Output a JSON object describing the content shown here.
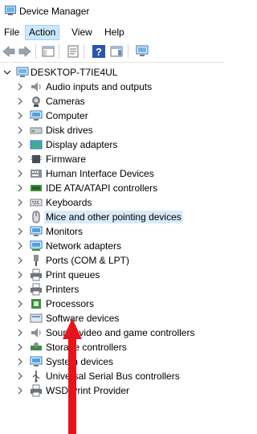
{
  "window": {
    "title": "Device Manager"
  },
  "menu": [
    {
      "label": "File",
      "active": false
    },
    {
      "label": "Action",
      "active": true
    },
    {
      "label": "View",
      "active": false
    },
    {
      "label": "Help",
      "active": false
    }
  ],
  "toolbar": {
    "buttons": [
      "back-arrow-icon",
      "forward-arrow-icon",
      "show-hide-console-tree-icon",
      "properties-icon",
      "help-icon",
      "action-pane-icon",
      "scan-hardware-changes-icon"
    ]
  },
  "tree": {
    "root": {
      "label": "DESKTOP-T7IE4UL"
    },
    "items": [
      {
        "label": "Audio inputs and outputs",
        "icon": "speaker-icon"
      },
      {
        "label": "Cameras",
        "icon": "camera-icon"
      },
      {
        "label": "Computer",
        "icon": "monitor-icon"
      },
      {
        "label": "Disk drives",
        "icon": "disk-drive-icon"
      },
      {
        "label": "Display adapters",
        "icon": "display-adapter-icon"
      },
      {
        "label": "Firmware",
        "icon": "chip-icon"
      },
      {
        "label": "Human Interface Devices",
        "icon": "hid-icon"
      },
      {
        "label": "IDE ATA/ATAPI controllers",
        "icon": "ide-controller-icon"
      },
      {
        "label": "Keyboards",
        "icon": "keyboard-icon"
      },
      {
        "label": "Mice and other pointing devices",
        "icon": "mouse-icon"
      },
      {
        "label": "Monitors",
        "icon": "monitor-icon"
      },
      {
        "label": "Network adapters",
        "icon": "network-icon"
      },
      {
        "label": "Ports (COM & LPT)",
        "icon": "port-icon"
      },
      {
        "label": "Print queues",
        "icon": "printer-icon"
      },
      {
        "label": "Printers",
        "icon": "printer-icon"
      },
      {
        "label": "Processors",
        "icon": "processor-icon"
      },
      {
        "label": "Software devices",
        "icon": "software-device-icon"
      },
      {
        "label": "Sound, video and game controllers",
        "icon": "speaker-icon"
      },
      {
        "label": "Storage controllers",
        "icon": "storage-controller-icon"
      },
      {
        "label": "System devices",
        "icon": "system-device-icon"
      },
      {
        "label": "Universal Serial Bus controllers",
        "icon": "usb-icon"
      },
      {
        "label": "WSD Print Provider",
        "icon": "printer-icon"
      }
    ],
    "selected_index": 9
  },
  "annotation": {
    "type": "red-up-arrow",
    "color": "#e8141c"
  },
  "colors": {
    "selection": "#d9ebf9",
    "menu_active": "#cce8ff",
    "arrow": "#e8141c"
  }
}
